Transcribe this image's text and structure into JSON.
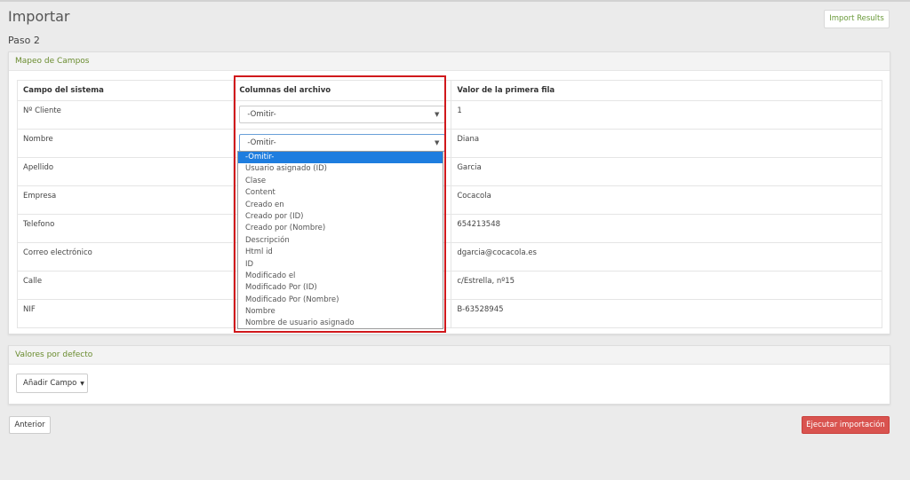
{
  "page": {
    "title": "Importar",
    "step": "Paso 2",
    "import_results_label": "Import Results"
  },
  "mapping": {
    "heading": "Mapeo de Campos",
    "columns": {
      "system_field": "Campo del sistema",
      "file_column": "Columnas del archivo",
      "first_row_value": "Valor de la primera fila"
    },
    "rows": [
      {
        "field": "Nº Cliente",
        "selected": "-Omitir-",
        "value": "1"
      },
      {
        "field": "Nombre",
        "selected": "-Omitir-",
        "value": "Diana"
      },
      {
        "field": "Apellido",
        "selected": "",
        "value": "Garcia"
      },
      {
        "field": "Empresa",
        "selected": "",
        "value": "Cocacola"
      },
      {
        "field": "Telefono",
        "selected": "",
        "value": "654213548"
      },
      {
        "field": "Correo electrónico",
        "selected": "",
        "value": "dgarcia@cocacola.es"
      },
      {
        "field": "Calle",
        "selected": "",
        "value": "c/Estrella, nº15"
      },
      {
        "field": "NIF",
        "selected": "",
        "value": "B-63528945"
      }
    ],
    "dropdown_options": [
      "-Omitir-",
      "Usuario asignado (ID)",
      "Clase",
      "Content",
      "Creado en",
      "Creado por (ID)",
      "Creado por (Nombre)",
      "Descripción",
      "Html id",
      "ID",
      "Modificado el",
      "Modificado Por (ID)",
      "Modificado Por (Nombre)",
      "Nombre",
      "Nombre de usuario asignado"
    ],
    "dropdown_selected_index": 0
  },
  "defaults": {
    "heading": "Valores por defecto",
    "add_field_label": "Añadir Campo"
  },
  "actions": {
    "previous_label": "Anterior",
    "run_import_label": "Ejecutar importación"
  },
  "colors": {
    "heading_green": "#6a8c2f",
    "danger": "#d9534f",
    "selection_blue": "#1e7ddf",
    "highlight_red": "#d0181c"
  }
}
